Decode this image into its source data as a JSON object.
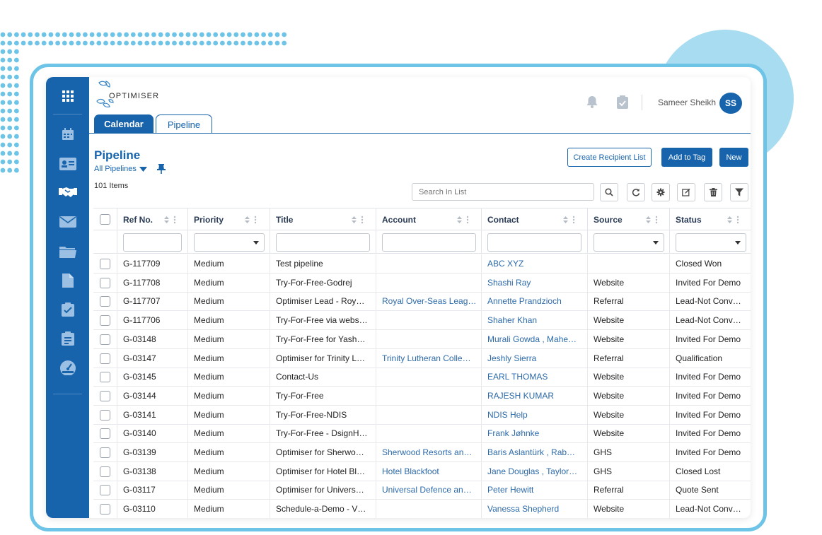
{
  "app": {
    "logo_text": "OPTIMISER",
    "user_name": "Sameer Sheikh",
    "user_initials": "SS"
  },
  "colors": {
    "brand_blue": "#1764ac",
    "accent_light_blue": "#6ec4e6",
    "link_blue": "#2d6aa9"
  },
  "sidebar": {
    "items": [
      {
        "icon": "apps-grid-icon"
      },
      {
        "icon": "calendar-icon"
      },
      {
        "icon": "contact-card-icon"
      },
      {
        "icon": "handshake-icon"
      },
      {
        "icon": "mail-icon"
      },
      {
        "icon": "folder-icon"
      },
      {
        "icon": "document-icon"
      },
      {
        "icon": "task-check-icon"
      },
      {
        "icon": "clipboard-list-icon"
      },
      {
        "icon": "dashboard-gauge-icon"
      }
    ]
  },
  "tabs": [
    {
      "label": "Calendar"
    },
    {
      "label": "Pipeline"
    }
  ],
  "page": {
    "title": "Pipeline",
    "pipeline_select": "All Pipelines",
    "items_count": "101 Items"
  },
  "toolbar": {
    "create_recipient_list": "Create Recipient List",
    "add_to_tag": "Add to Tag",
    "new": "New",
    "search_placeholder": "Search In List"
  },
  "table": {
    "columns": [
      "Ref No.",
      "Priority",
      "Title",
      "Account",
      "Contact",
      "Source",
      "Status"
    ],
    "rows": [
      [
        "G-117709",
        "Medium",
        "Test pipeline",
        "",
        "ABC XYZ",
        "",
        "Closed Won"
      ],
      [
        "G-117708",
        "Medium",
        "Try-For-Free-Godrej",
        "",
        "Shashi Ray",
        "Website",
        "Invited For Demo"
      ],
      [
        "G-117707",
        "Medium",
        "Optimiser Lead - Roy…",
        "Royal Over-Seas Leag…",
        "Annette Prandzioch",
        "Referral",
        "Lead-Not Conv…"
      ],
      [
        "G-117706",
        "Medium",
        "Try-For-Free via webs…",
        "",
        "Shaher Khan",
        "Website",
        "Lead-Not Conv…"
      ],
      [
        "G-03148",
        "Medium",
        "Try-For-Free for Yash…",
        "",
        "Murali Gowda , Mahe…",
        "Website",
        "Invited For Demo"
      ],
      [
        "G-03147",
        "Medium",
        "Optimiser for Trinity L…",
        "Trinity Lutheran Colle…",
        "Jeshly Sierra",
        "Referral",
        "Qualification"
      ],
      [
        "G-03145",
        "Medium",
        "Contact-Us",
        "",
        "EARL THOMAS",
        "Website",
        "Invited For Demo"
      ],
      [
        "G-03144",
        "Medium",
        "Try-For-Free",
        "",
        "RAJESH KUMAR",
        "Website",
        "Invited For Demo"
      ],
      [
        "G-03141",
        "Medium",
        "Try-For-Free-NDIS",
        "",
        "NDIS Help",
        "Website",
        "Invited For Demo"
      ],
      [
        "G-03140",
        "Medium",
        "Try-For-Free - DsignH…",
        "",
        "Frank Jøhnke",
        "Website",
        "Invited For Demo"
      ],
      [
        "G-03139",
        "Medium",
        "Optimiser for Sherwo…",
        "Sherwood Resorts an…",
        "Baris Aslantürk , Rab…",
        "GHS",
        "Invited For Demo"
      ],
      [
        "G-03138",
        "Medium",
        "Optimiser for Hotel Bl…",
        "Hotel Blackfoot",
        "Jane Douglas , Taylor…",
        "GHS",
        "Closed Lost"
      ],
      [
        "G-03117",
        "Medium",
        "Optimiser for Univers…",
        "Universal Defence an…",
        "Peter Hewitt",
        "Referral",
        "Quote Sent"
      ],
      [
        "G-03110",
        "Medium",
        "Schedule-a-Demo - V…",
        "",
        "Vanessa Shepherd",
        "Website",
        "Lead-Not Conv…"
      ]
    ]
  }
}
